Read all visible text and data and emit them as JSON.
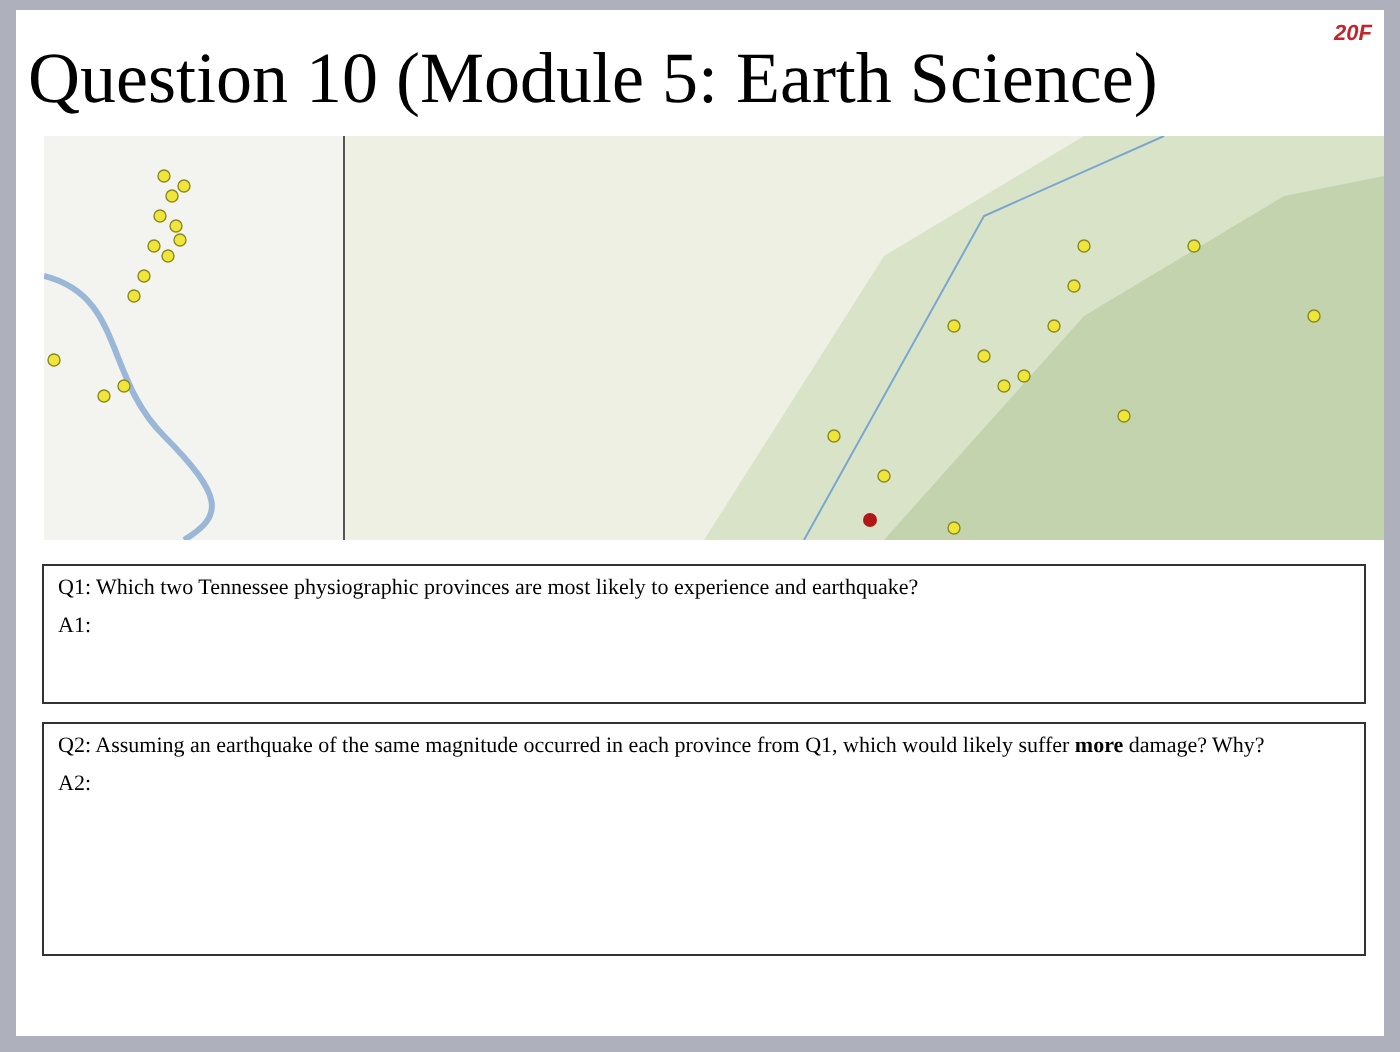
{
  "slide": {
    "badge": "20F",
    "title": "Question 10 (Module 5: Earth Science)"
  },
  "questions": [
    {
      "question": "Q1: Which two Tennessee physiographic provinces are most likely to experience and earthquake?",
      "answer_label": "A1:",
      "kind": "short"
    },
    {
      "question": "Q2: Assuming an earthquake of the same magnitude occurred in each province from Q1, which would likely suffer **more** damage? Why?",
      "answer_label": "A2:",
      "kind": "long"
    }
  ]
}
